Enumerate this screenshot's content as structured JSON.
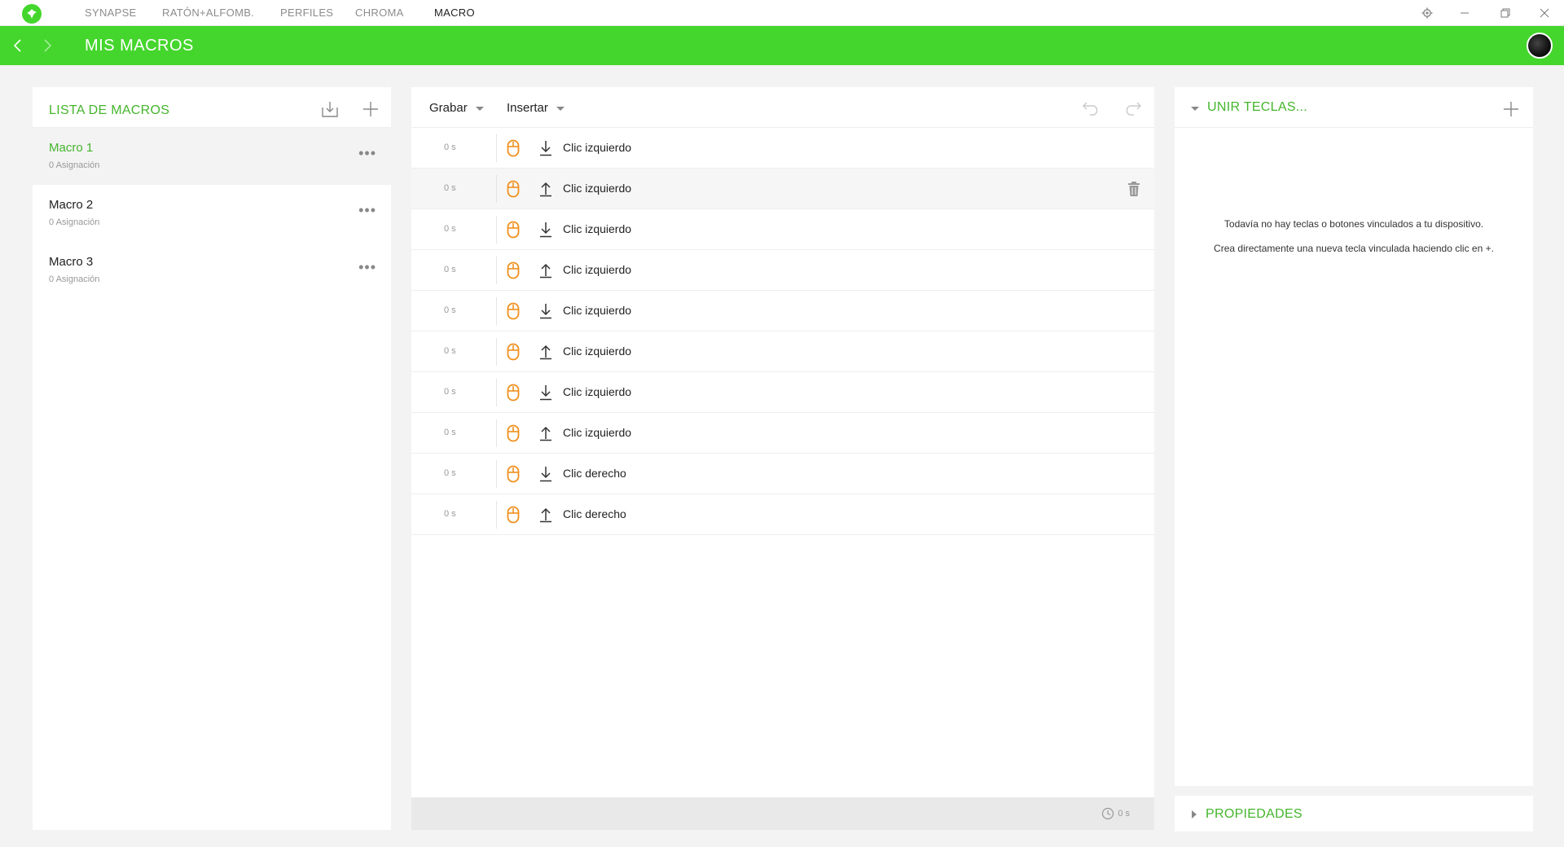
{
  "titlebar": {
    "tabs": [
      {
        "label": "SYNAPSE"
      },
      {
        "label": "RATÓN+ALFOMB."
      },
      {
        "label": "PERFILES"
      },
      {
        "label": "CHROMA"
      },
      {
        "label": "MACRO"
      }
    ],
    "active_tab": "MACRO"
  },
  "header": {
    "title": "MIS MACROS"
  },
  "macro_list": {
    "title": "LISTA DE MACROS",
    "items": [
      {
        "name": "Macro 1",
        "sub": "0 Asignación"
      },
      {
        "name": "Macro 2",
        "sub": "0 Asignación"
      },
      {
        "name": "Macro 3",
        "sub": "0 Asignación"
      }
    ]
  },
  "editor": {
    "record_label": "Grabar",
    "insert_label": "Insertar",
    "steps": [
      {
        "delay": "0 s",
        "direction": "down",
        "label": "Clic izquierdo"
      },
      {
        "delay": "0 s",
        "direction": "up",
        "label": "Clic izquierdo"
      },
      {
        "delay": "0 s",
        "direction": "down",
        "label": "Clic izquierdo"
      },
      {
        "delay": "0 s",
        "direction": "up",
        "label": "Clic izquierdo"
      },
      {
        "delay": "0 s",
        "direction": "down",
        "label": "Clic izquierdo"
      },
      {
        "delay": "0 s",
        "direction": "up",
        "label": "Clic izquierdo"
      },
      {
        "delay": "0 s",
        "direction": "down",
        "label": "Clic izquierdo"
      },
      {
        "delay": "0 s",
        "direction": "up",
        "label": "Clic izquierdo"
      },
      {
        "delay": "0 s",
        "direction": "down",
        "label": "Clic derecho"
      },
      {
        "delay": "0 s",
        "direction": "up",
        "label": "Clic derecho"
      }
    ],
    "total_time": "0 s"
  },
  "bind_keys": {
    "title": "UNIR TECLAS...",
    "empty_line1": "Todavía no hay teclas o botones vinculados a tu dispositivo.",
    "empty_line2": "Crea directamente una nueva tecla vinculada haciendo clic en +."
  },
  "properties": {
    "title": "PROPIEDADES"
  },
  "colors": {
    "brand_green": "#44d62c",
    "accent_text_green": "#44b52c",
    "mouse_icon_orange": "#f0901e"
  }
}
